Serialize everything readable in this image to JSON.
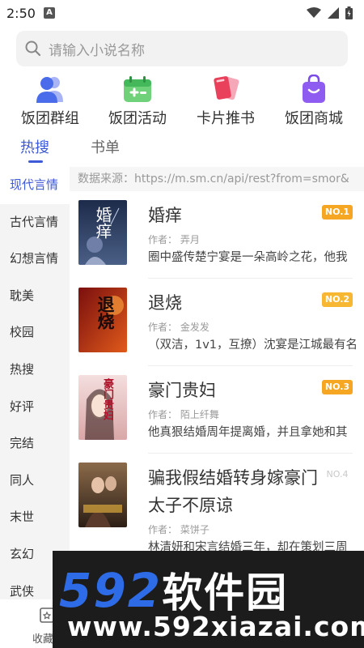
{
  "status_bar": {
    "time": "2:50",
    "notif_letter": "A"
  },
  "search": {
    "placeholder": "请输入小说名称"
  },
  "shortcuts": [
    {
      "label": "饭团群组",
      "icon": "group-icon"
    },
    {
      "label": "饭团活动",
      "icon": "activity-icon"
    },
    {
      "label": "卡片推书",
      "icon": "cards-icon"
    },
    {
      "label": "饭团商城",
      "icon": "shop-bag-icon"
    }
  ],
  "tabs": [
    {
      "label": "热搜",
      "active": true
    },
    {
      "label": "书单",
      "active": false
    }
  ],
  "sidebar": {
    "items": [
      "现代言情",
      "古代言情",
      "幻想言情",
      "耽美",
      "校园",
      "热搜",
      "好评",
      "完结",
      "同人",
      "末世",
      "玄幻",
      "武侠"
    ],
    "active_index": 0
  },
  "main": {
    "source_text": "数据来源：https://m.sm.cn/api/rest?from=smor&",
    "books": [
      {
        "title": "婚痒",
        "rank": "NO.1",
        "author": "作者：  弄月",
        "desc": "圈中盛传楚宁宴是一朵高岭之花，他我",
        "cover_text": "婚痒"
      },
      {
        "title": "退烧",
        "rank": "NO.2",
        "author": "作者：  金发发",
        "desc": "（双洁，1v1，互撩）沈宴是江城最有名",
        "cover_text": "退烧"
      },
      {
        "title": "豪门贵妇",
        "rank": "NO.3",
        "author": "作者：  陌上纤舞",
        "desc": "他真狠结婚周年提离婚，并且拿她和其",
        "cover_text": "豪门贵妇"
      },
      {
        "title_line1": "骗我假结婚转身嫁豪门",
        "title_line2": "太子不原谅",
        "rank": "NO.4",
        "author": "作者：  菜饼子",
        "desc": "林清妍和宋言结婚三年，却在策划三周"
      }
    ]
  },
  "bottom_nav": {
    "label": "收藏"
  },
  "watermark": {
    "big_digits": "592",
    "big_cn": "软件园",
    "url": "www.592xiazai.com"
  },
  "colors": {
    "accent": "#3f5ad8",
    "rank1": "#f5a623",
    "rank2": "#f7b733",
    "rank3": "#f5a623",
    "rank4": "#cccccc"
  }
}
